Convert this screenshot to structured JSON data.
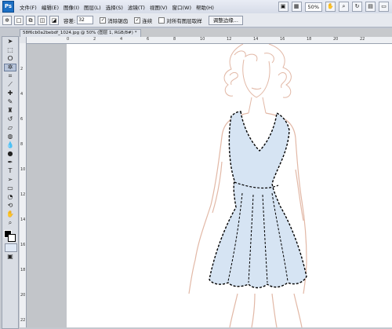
{
  "app": {
    "logo_text": "Ps"
  },
  "menu": {
    "items": [
      "文件(F)",
      "编辑(E)",
      "图像(I)",
      "图层(L)",
      "选择(S)",
      "滤镜(T)",
      "视图(V)",
      "窗口(W)",
      "帮助(H)"
    ],
    "zoom": "50%"
  },
  "options": {
    "feather_label": "容差:",
    "feather_value": "32",
    "antialias_label": "消除锯齿",
    "contiguous_label": "连续",
    "all_layers_label": "对所有图层取样",
    "refine_button": "调整边缘..."
  },
  "document": {
    "tab_title": "58f6cb0a2bebdf_1024.jpg @ 50% (图层 1, RGB/8#) *",
    "ruler_top_ticks": [
      "0",
      "2",
      "4",
      "6",
      "8",
      "10",
      "12",
      "14",
      "16",
      "18",
      "20",
      "22",
      "24"
    ],
    "ruler_left_ticks": [
      "2",
      "4",
      "6",
      "8",
      "10",
      "12",
      "14",
      "16",
      "18",
      "20",
      "22"
    ]
  },
  "colors": {
    "dress_fill": "#d6e4f3",
    "sketch_line": "#e2b8a6",
    "selection": "#000000"
  }
}
